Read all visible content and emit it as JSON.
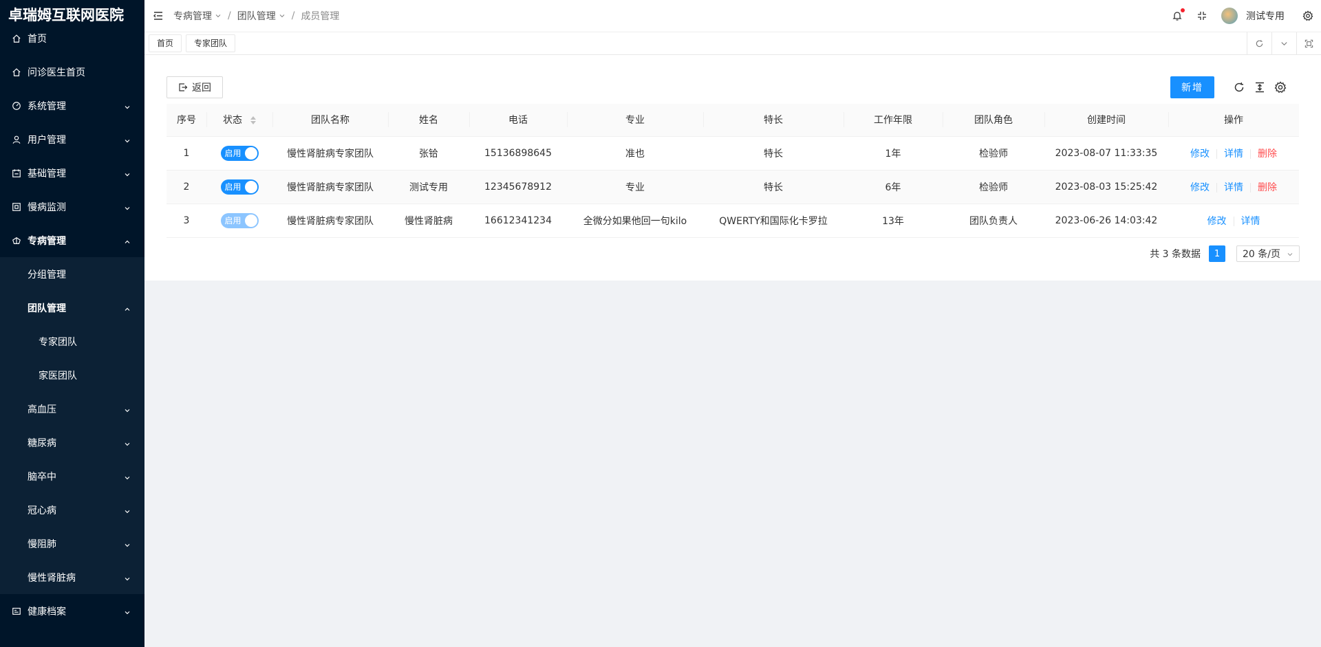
{
  "app_title": "卓瑞姆互联网医院",
  "sidebar": {
    "items": [
      {
        "label": "首页",
        "icon": "home-icon"
      },
      {
        "label": "问诊医生首页",
        "icon": "home-icon"
      },
      {
        "label": "系统管理",
        "icon": "dashboard-icon"
      },
      {
        "label": "用户管理",
        "icon": "user-icon"
      },
      {
        "label": "基础管理",
        "icon": "calendar-icon"
      },
      {
        "label": "慢病监测",
        "icon": "monitor-icon"
      },
      {
        "label": "专病管理",
        "icon": "gift-icon"
      }
    ],
    "sub_items": {
      "group_manage": "分组管理",
      "team_manage": "团队管理",
      "expert_team": "专家团队",
      "family_team": "家医团队",
      "hypertension": "高血压",
      "diabetes": "糖尿病",
      "stroke": "脑卒中",
      "chd": "冠心病",
      "copd": "慢阻肺",
      "ckd": "慢性肾脏病"
    },
    "health_record": "健康档案"
  },
  "header": {
    "breadcrumb": [
      "专病管理",
      "团队管理",
      "成员管理"
    ],
    "user_name": "测试专用"
  },
  "tabs": [
    "首页",
    "专家团队"
  ],
  "toolbar": {
    "back_label": "返回",
    "add_label": "新增"
  },
  "table": {
    "columns": [
      "序号",
      "状态",
      "团队名称",
      "姓名",
      "电话",
      "专业",
      "特长",
      "工作年限",
      "团队角色",
      "创建时间",
      "操作"
    ],
    "rows": [
      {
        "index": "1",
        "status": "启用",
        "team": "慢性肾脏病专家团队",
        "name": "张铪",
        "phone": "15136898645",
        "major": "准也",
        "specialty": "特长",
        "years": "1年",
        "role": "检验师",
        "created": "2023-08-07 11:33:35"
      },
      {
        "index": "2",
        "status": "启用",
        "team": "慢性肾脏病专家团队",
        "name": "测试专用",
        "phone": "12345678912",
        "major": "专业",
        "specialty": "特长",
        "years": "6年",
        "role": "检验师",
        "created": "2023-08-03 15:25:42"
      },
      {
        "index": "3",
        "status": "启用",
        "team": "慢性肾脏病专家团队",
        "name": "慢性肾脏病",
        "phone": "16612341234",
        "major": "全微分如果他回一句kilo",
        "specialty": "QWERTY和国际化卡罗拉",
        "years": "13年",
        "role": "团队负责人",
        "created": "2023-06-26 14:03:42"
      }
    ],
    "actions": {
      "edit": "修改",
      "detail": "详情",
      "delete": "删除"
    }
  },
  "pagination": {
    "total_text": "共 3 条数据",
    "current_page": "1",
    "page_size": "20 条/页"
  },
  "colors": {
    "sidebar_bg": "#001529",
    "primary": "#1890ff",
    "danger": "#ff4d4f"
  }
}
